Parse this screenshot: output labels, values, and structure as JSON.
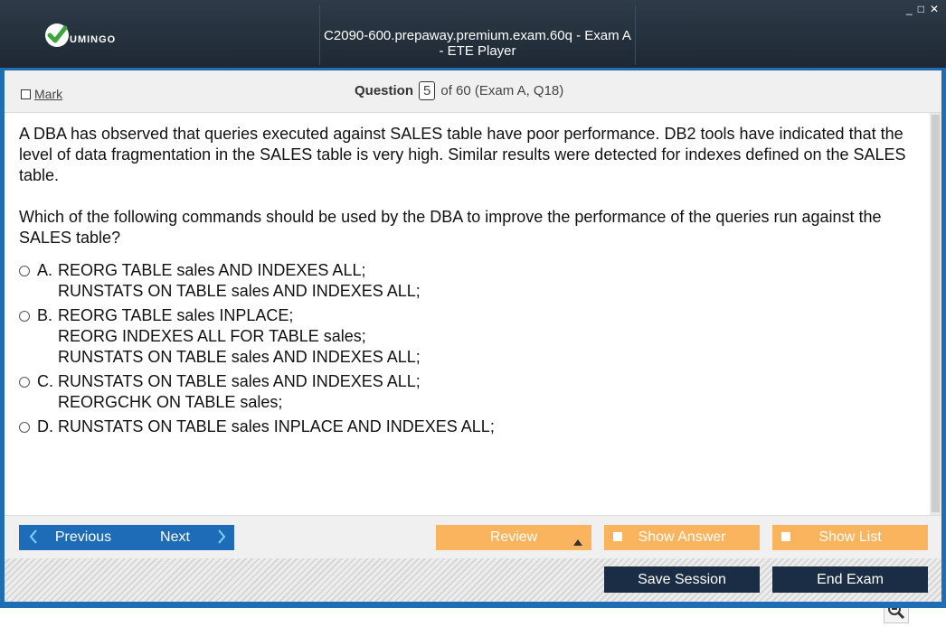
{
  "titlebar": {
    "logo_text": "UMINGO",
    "title": "C2090-600.prepaway.premium.exam.60q - Exam A - ETE Player",
    "controls": [
      "_",
      "□",
      "✕"
    ]
  },
  "question_bar": {
    "mark_label": "Mark",
    "question_label": "Question",
    "question_number": "5",
    "question_total": "of 60 (Exam A, Q18)"
  },
  "question": {
    "paragraph1": "A DBA has observed that queries executed against SALES table have poor performance. DB2 tools have indicated that the level of data fragmentation in the SALES table is very high. Similar results were detected for indexes defined on the SALES table.",
    "paragraph2": "Which of the following commands should be used by the DBA to improve the performance of the queries run against the SALES table?"
  },
  "options": [
    {
      "letter": "A.",
      "lines": [
        "REORG TABLE sales AND INDEXES ALL;",
        "RUNSTATS ON TABLE sales AND INDEXES ALL;"
      ]
    },
    {
      "letter": "B.",
      "lines": [
        "REORG TABLE sales INPLACE;",
        "REORG INDEXES ALL FOR TABLE sales;",
        "RUNSTATS ON TABLE sales AND INDEXES ALL;"
      ]
    },
    {
      "letter": "C.",
      "lines": [
        "RUNSTATS ON TABLE sales AND INDEXES ALL;",
        "REORGCHK ON TABLE sales;"
      ]
    },
    {
      "letter": "D.",
      "lines": [
        "RUNSTATS ON TABLE sales INPLACE AND INDEXES ALL;"
      ]
    }
  ],
  "navigation": {
    "previous_label": "Previous",
    "next_label": "Next",
    "review_label": "Review",
    "show_answer_label": "Show Answer",
    "show_list_label": "Show List"
  },
  "footer": {
    "save_session_label": "Save Session",
    "end_exam_label": "End Exam"
  },
  "icons": {
    "zoom": [
      "search-icon",
      "zoom-in-icon",
      "zoom-out-icon"
    ]
  },
  "colors": {
    "titlebar": "#1d2833",
    "accent_blue": "#1e6bb8",
    "orange": "#fbb45e",
    "dark_button": "#1a2d44"
  }
}
